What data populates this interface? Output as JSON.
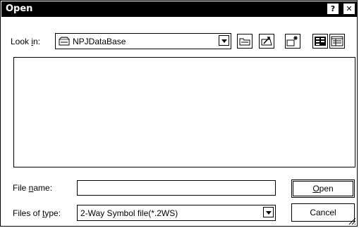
{
  "window": {
    "title": "Open",
    "help_label": "?",
    "close_label": "✕"
  },
  "lookin": {
    "label_pre": "Look ",
    "label_key": "i",
    "label_post": "n:",
    "value": "NPJDataBase"
  },
  "toolbar": {
    "icons": [
      "folder-icon",
      "up-folder-icon",
      "new-folder-icon",
      "list-view-icon",
      "details-view-icon"
    ]
  },
  "filename": {
    "label_pre": "File ",
    "label_key": "n",
    "label_post": "ame:",
    "value": ""
  },
  "filetype": {
    "label_pre": "Files of ",
    "label_key": "t",
    "label_post": "ype:",
    "value": "2-Way Symbol file(*.2WS)"
  },
  "buttons": {
    "open_key": "O",
    "open_rest": "pen",
    "cancel": "Cancel"
  }
}
